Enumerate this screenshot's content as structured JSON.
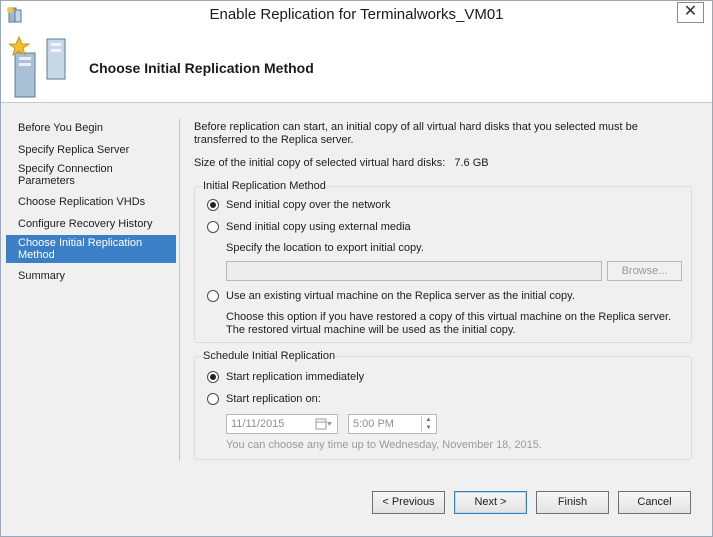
{
  "window": {
    "title": "Enable Replication for Terminalworks_VM01",
    "close_glyph": "✕"
  },
  "header": {
    "title": "Choose Initial Replication Method"
  },
  "nav": {
    "items": [
      {
        "label": "Before You Begin",
        "active": false
      },
      {
        "label": "Specify Replica Server",
        "active": false
      },
      {
        "label": "Specify Connection Parameters",
        "active": false
      },
      {
        "label": "Choose Replication VHDs",
        "active": false
      },
      {
        "label": "Configure Recovery History",
        "active": false
      },
      {
        "label": "Choose Initial Replication Method",
        "active": true
      },
      {
        "label": "Summary",
        "active": false
      }
    ]
  },
  "main": {
    "intro": "Before replication can start, an initial copy of all virtual hard disks that you selected must be transferred to the Replica server.",
    "size_label": "Size of the initial copy of selected virtual hard disks:",
    "size_value": "7.6 GB",
    "method_group": {
      "label": "Initial Replication Method",
      "option_network": "Send initial copy over the network",
      "option_media": "Send initial copy using external media",
      "media_location_label": "Specify the location to export initial copy.",
      "media_path_value": "",
      "browse_label": "Browse...",
      "option_existing": "Use an existing virtual machine on the Replica server as the initial copy.",
      "existing_description": "Choose this option if you have restored a copy of this virtual machine on the Replica server. The restored virtual machine will be used as the initial copy.",
      "selected": "network"
    },
    "schedule_group": {
      "label": "Schedule Initial Replication",
      "option_immediately": "Start replication immediately",
      "option_on": "Start replication on:",
      "date_value": "11/11/2015",
      "time_value": "5:00 PM",
      "hint": "You can choose any time up to Wednesday, November 18, 2015.",
      "selected": "immediately"
    }
  },
  "footer": {
    "previous": "< Previous",
    "next": "Next >",
    "finish": "Finish",
    "cancel": "Cancel"
  },
  "icons": {
    "title_icon": "replication-icon",
    "header_icon": "server-replication-icon"
  },
  "colors": {
    "accent": "#3b7fc6",
    "window_bg": "#f0f0f0"
  }
}
